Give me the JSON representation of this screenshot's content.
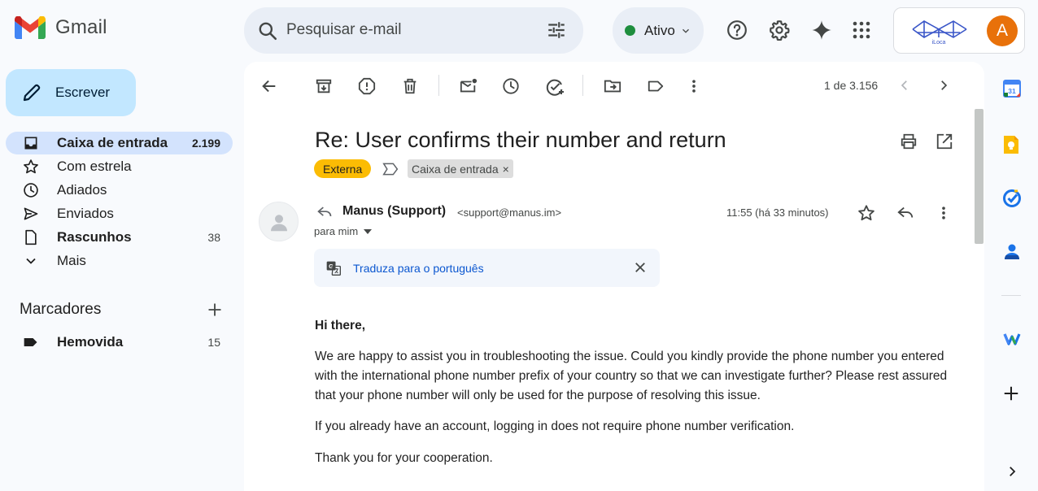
{
  "header": {
    "app_name": "Gmail",
    "search_placeholder": "Pesquisar e-mail",
    "status_label": "Ativo",
    "org_logo_text": "iLoca",
    "avatar_initial": "A",
    "status_color": "#1e8e3e",
    "avatar_color": "#e8710a"
  },
  "sidebar": {
    "compose_label": "Escrever",
    "items": [
      {
        "label": "Caixa de entrada",
        "count": "2.199",
        "icon": "inbox-icon",
        "active": true,
        "bold": true
      },
      {
        "label": "Com estrela",
        "count": "",
        "icon": "star-icon"
      },
      {
        "label": "Adiados",
        "count": "",
        "icon": "clock-icon"
      },
      {
        "label": "Enviados",
        "count": "",
        "icon": "send-icon"
      },
      {
        "label": "Rascunhos",
        "count": "38",
        "icon": "draft-icon",
        "bold": true
      },
      {
        "label": "Mais",
        "count": "",
        "icon": "chevron-down-icon"
      }
    ],
    "labels_title": "Marcadores",
    "labels": [
      {
        "label": "Hemovida",
        "count": "15",
        "icon": "label-icon"
      }
    ]
  },
  "toolbar": {
    "page_count": "1 de 3.156"
  },
  "email": {
    "subject": "Re: User confirms their number and return",
    "tags": {
      "externa": "Externa",
      "inbox": "Caixa de entrada",
      "remove": "×"
    },
    "sender_name": "Manus (Support)",
    "sender_email": "<support@manus.im>",
    "recipient": "para mim",
    "time": "11:55 (há 33 minutos)",
    "translate_link": "Traduza para o português",
    "greeting": "Hi there,",
    "paragraphs": [
      "We are happy to assist you in troubleshooting the issue. Could you kindly provide the phone number you entered with the international phone number prefix of your country so that we can investigate further? Please rest assured that your phone number will only be used for the purpose of resolving this issue.",
      "If you already have an account, logging in does not require phone number verification.",
      "Thank you for your cooperation."
    ]
  },
  "colors": {
    "accent": "#0b57d0",
    "compose_bg": "#c2e7ff",
    "active_nav_bg": "#d3e3fd",
    "externa_tag": "#fbbc04"
  }
}
